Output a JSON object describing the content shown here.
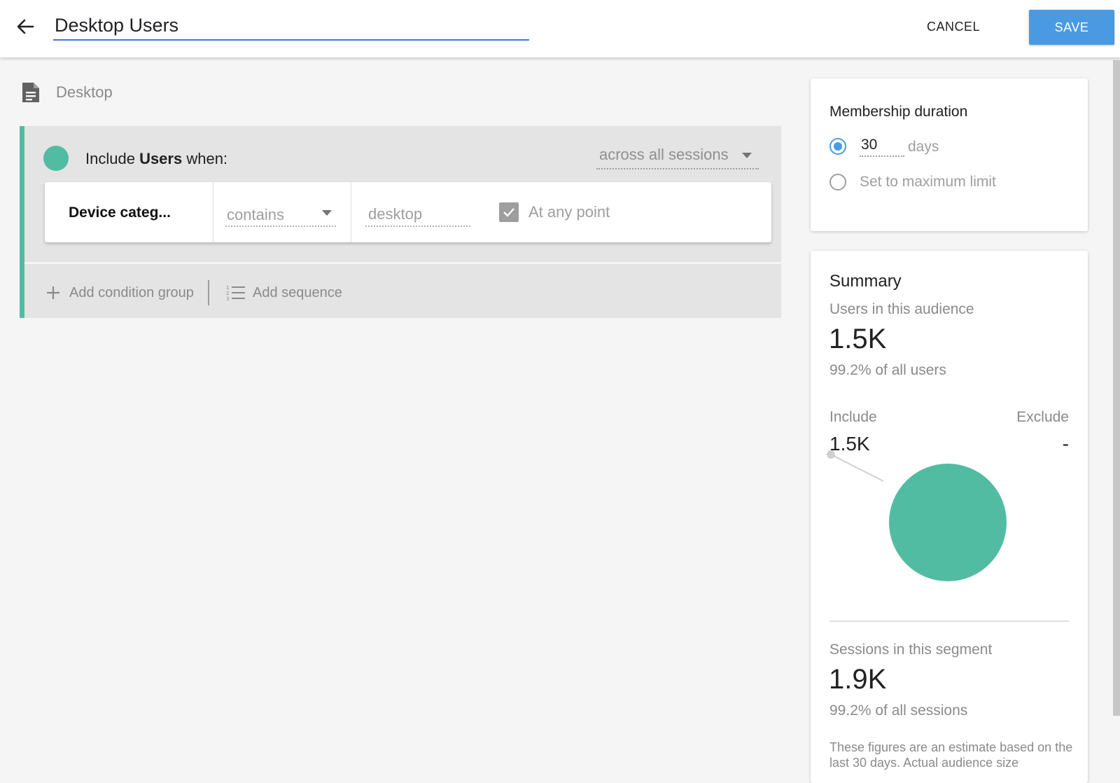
{
  "header": {
    "title_value": "Desktop Users",
    "cancel_label": "CANCEL",
    "save_label": "SAVE"
  },
  "segment": {
    "name": "Desktop",
    "include_prefix": "Include ",
    "include_entity": "Users",
    "include_suffix": " when:",
    "scope": "across all sessions",
    "condition": {
      "dimension": "Device categ...",
      "operator": "contains",
      "value_placeholder": "desktop",
      "at_any_point_label": "At any point",
      "at_any_point_checked": true
    },
    "add_condition_group_label": "Add condition group",
    "add_sequence_label": "Add sequence"
  },
  "membership": {
    "title": "Membership duration",
    "days_value": "30",
    "days_label": "days",
    "max_limit_label": "Set to maximum limit",
    "selected": "days"
  },
  "summary": {
    "title": "Summary",
    "users_label": "Users in this audience",
    "users_value": "1.5K",
    "users_pct": "99.2% of all users",
    "include_label": "Include",
    "exclude_label": "Exclude",
    "include_value": "1.5K",
    "exclude_value": "-",
    "sessions_label": "Sessions in this segment",
    "sessions_value": "1.9K",
    "sessions_pct": "99.2% of all sessions",
    "note": "These figures are an estimate based on the last 30 days. Actual audience size"
  },
  "colors": {
    "accent": "#4a9ae3",
    "include_green": "#52bca3"
  },
  "icons": {
    "back": "arrow-left-icon",
    "segment": "document-icon",
    "add": "plus-icon",
    "sequence": "numbered-list-icon",
    "dropdown": "caret-down-icon",
    "check": "checkmark-icon"
  }
}
